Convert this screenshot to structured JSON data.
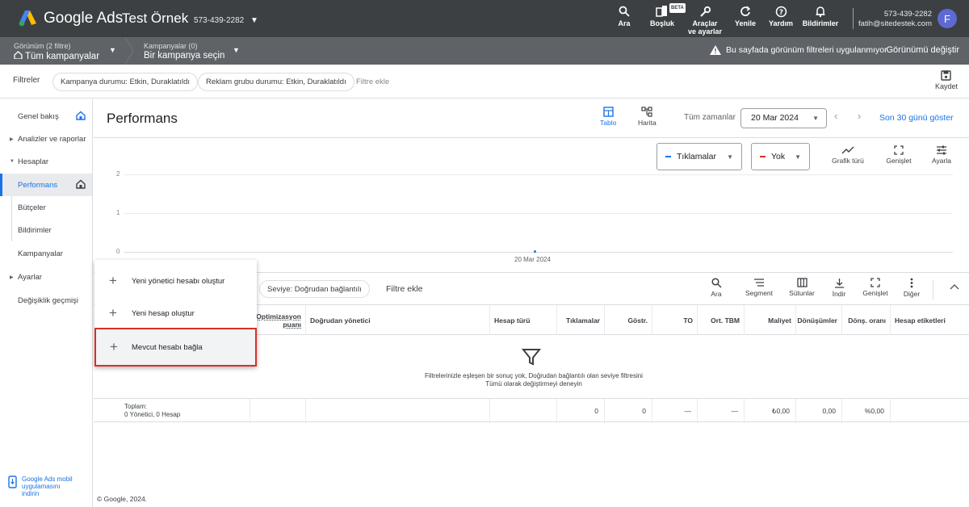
{
  "topbar": {
    "brand": "Google Ads",
    "account_name": "Test Örnek",
    "account_id": "573-439-2282",
    "tools": [
      {
        "icon": "search-icon",
        "label": "Ara"
      },
      {
        "icon": "tablet-icon",
        "label": "Boşluk",
        "badge": "BETA"
      },
      {
        "icon": "wrench-icon",
        "label_1": "Araçlar",
        "label_2": "ve ayarlar"
      },
      {
        "icon": "refresh-icon",
        "label": "Yenile"
      },
      {
        "icon": "help-icon",
        "label": "Yardım"
      },
      {
        "icon": "bell-icon",
        "label": "Bildirimler"
      }
    ],
    "user_id": "573-439-2282",
    "user_email": "fatih@sitedestek.com",
    "avatar_letter": "F"
  },
  "bar2": {
    "view_sub": "Görünüm (2 filtre)",
    "view_main": "Tüm kampanyalar",
    "campaign_sub": "Kampanyalar (0)",
    "campaign_main": "Bir kampanya seçin",
    "warning": "Bu sayfada görünüm filtreleri uygulanmıyor",
    "view_change": "Görünümü değiştir"
  },
  "filters": {
    "label": "Filtreler",
    "chips": [
      "Kampanya durumu: Etkin, Duraklatıldı",
      "Reklam grubu durumu: Etkin, Duraklatıldı"
    ],
    "add": "Filtre ekle",
    "save": "Kaydet"
  },
  "sidebar": {
    "items": [
      "Genel bakış",
      "Analizler ve raporlar",
      "Hesaplar",
      "Performans",
      "Bütçeler",
      "Bildirimler",
      "Kampanyalar",
      "Ayarlar",
      "Değişiklik geçmişi"
    ],
    "mobile_1": "Google Ads mobil",
    "mobile_2": "uygulamasını",
    "mobile_3": "indirin"
  },
  "performance": {
    "title": "Performans",
    "tab_table": "Tablo",
    "tab_map": "Harita",
    "date_label": "Tüm zamanlar",
    "date_value": "20 Mar 2024",
    "show_30": "Son 30 günü göster"
  },
  "chart": {
    "metric_1": "Tıklamalar",
    "metric_1_color": "#1a73e8",
    "metric_2": "Yok",
    "metric_2_color": "#d93025",
    "tool_type": "Grafik türü",
    "tool_expand": "Genişlet",
    "tool_adjust": "Ayarla"
  },
  "chart_data": {
    "type": "line",
    "x": [
      "20 Mar 2024"
    ],
    "series": [
      {
        "values": [
          0
        ]
      }
    ],
    "y_ticks": [
      "2",
      "1",
      "0"
    ],
    "ylim": [
      0,
      2
    ]
  },
  "table": {
    "level_chip": "Seviye: Doğrudan bağlantılı",
    "filter_add": "Filtre ekle",
    "tools": [
      "Ara",
      "Segment",
      "Sütunlar",
      "İndir",
      "Genişlet",
      "Diğer"
    ],
    "columns": {
      "opt_1": "Optimizasyon",
      "opt_2": "puanı",
      "manager": "Doğrudan yönetici",
      "type": "Hesap türü",
      "clicks": "Tıklamalar",
      "impr": "Göstr.",
      "ctr": "TO",
      "cpc": "Ort. TBM",
      "cost": "Maliyet",
      "conv": "Dönüşümler",
      "conv_rate": "Dönş. oranı",
      "labels": "Hesap etiketleri"
    },
    "empty_1": "Filtrelerinizle eşleşen bir sonuç yok, Doğrudan bağlantılı olan seviye filtresini",
    "empty_2": "Tümü olarak değiştirmeyi deneyin",
    "total_label": "Toplam:",
    "total_sub": "0 Yönetici, 0 Hesap",
    "totals": {
      "clicks": "0",
      "impr": "0",
      "ctr": "—",
      "cpc": "—",
      "cost": "₺0,00",
      "conv": "0,00",
      "conv_rate": "%0,00"
    }
  },
  "menu": {
    "items": [
      "Yeni yönetici hesabı oluştur",
      "Yeni hesap oluştur",
      "Mevcut hesabı bağla"
    ]
  },
  "footer": "© Google, 2024."
}
